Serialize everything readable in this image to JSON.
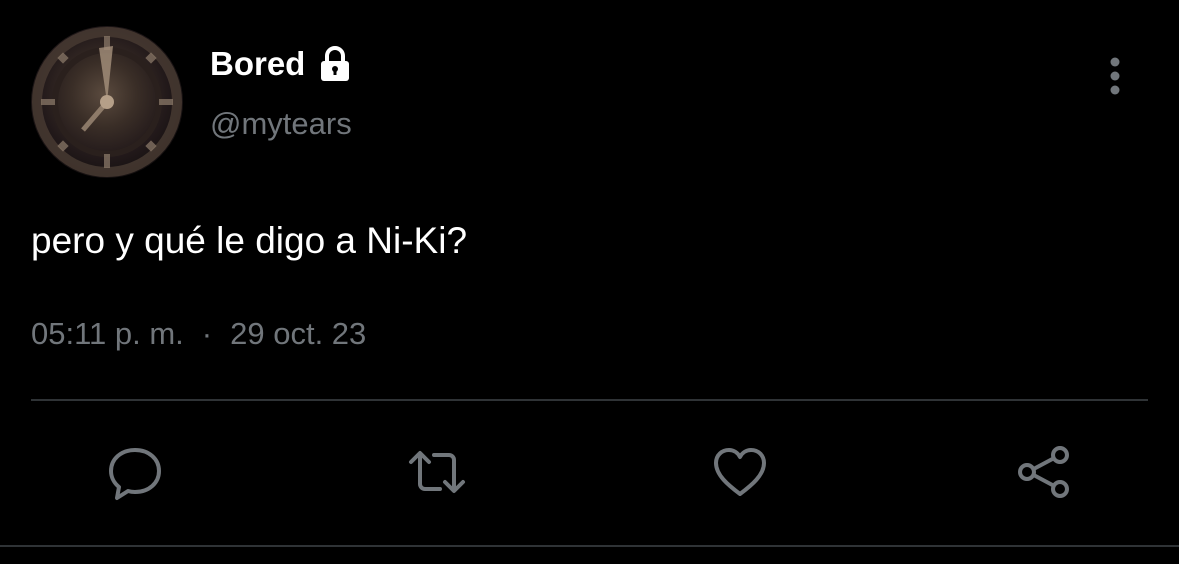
{
  "tweet": {
    "author": {
      "display_name": "Bored",
      "handle": "@mytears",
      "protected_icon": "lock-icon",
      "avatar_icon": "clock-avatar"
    },
    "text": "pero y qué le digo a Ni-Ki?",
    "time": "05:11 p. m.",
    "separator": "·",
    "date": "29 oct. 23"
  },
  "actions": [
    {
      "name": "reply",
      "icon": "speech-bubble-icon"
    },
    {
      "name": "retweet",
      "icon": "retweet-arrows-icon"
    },
    {
      "name": "like",
      "icon": "heart-icon"
    },
    {
      "name": "share",
      "icon": "share-icon"
    }
  ],
  "colors": {
    "background": "#000000",
    "text_primary": "#ffffff",
    "text_secondary": "#71767b",
    "divider": "#2f3336",
    "icon": "#71767b"
  }
}
